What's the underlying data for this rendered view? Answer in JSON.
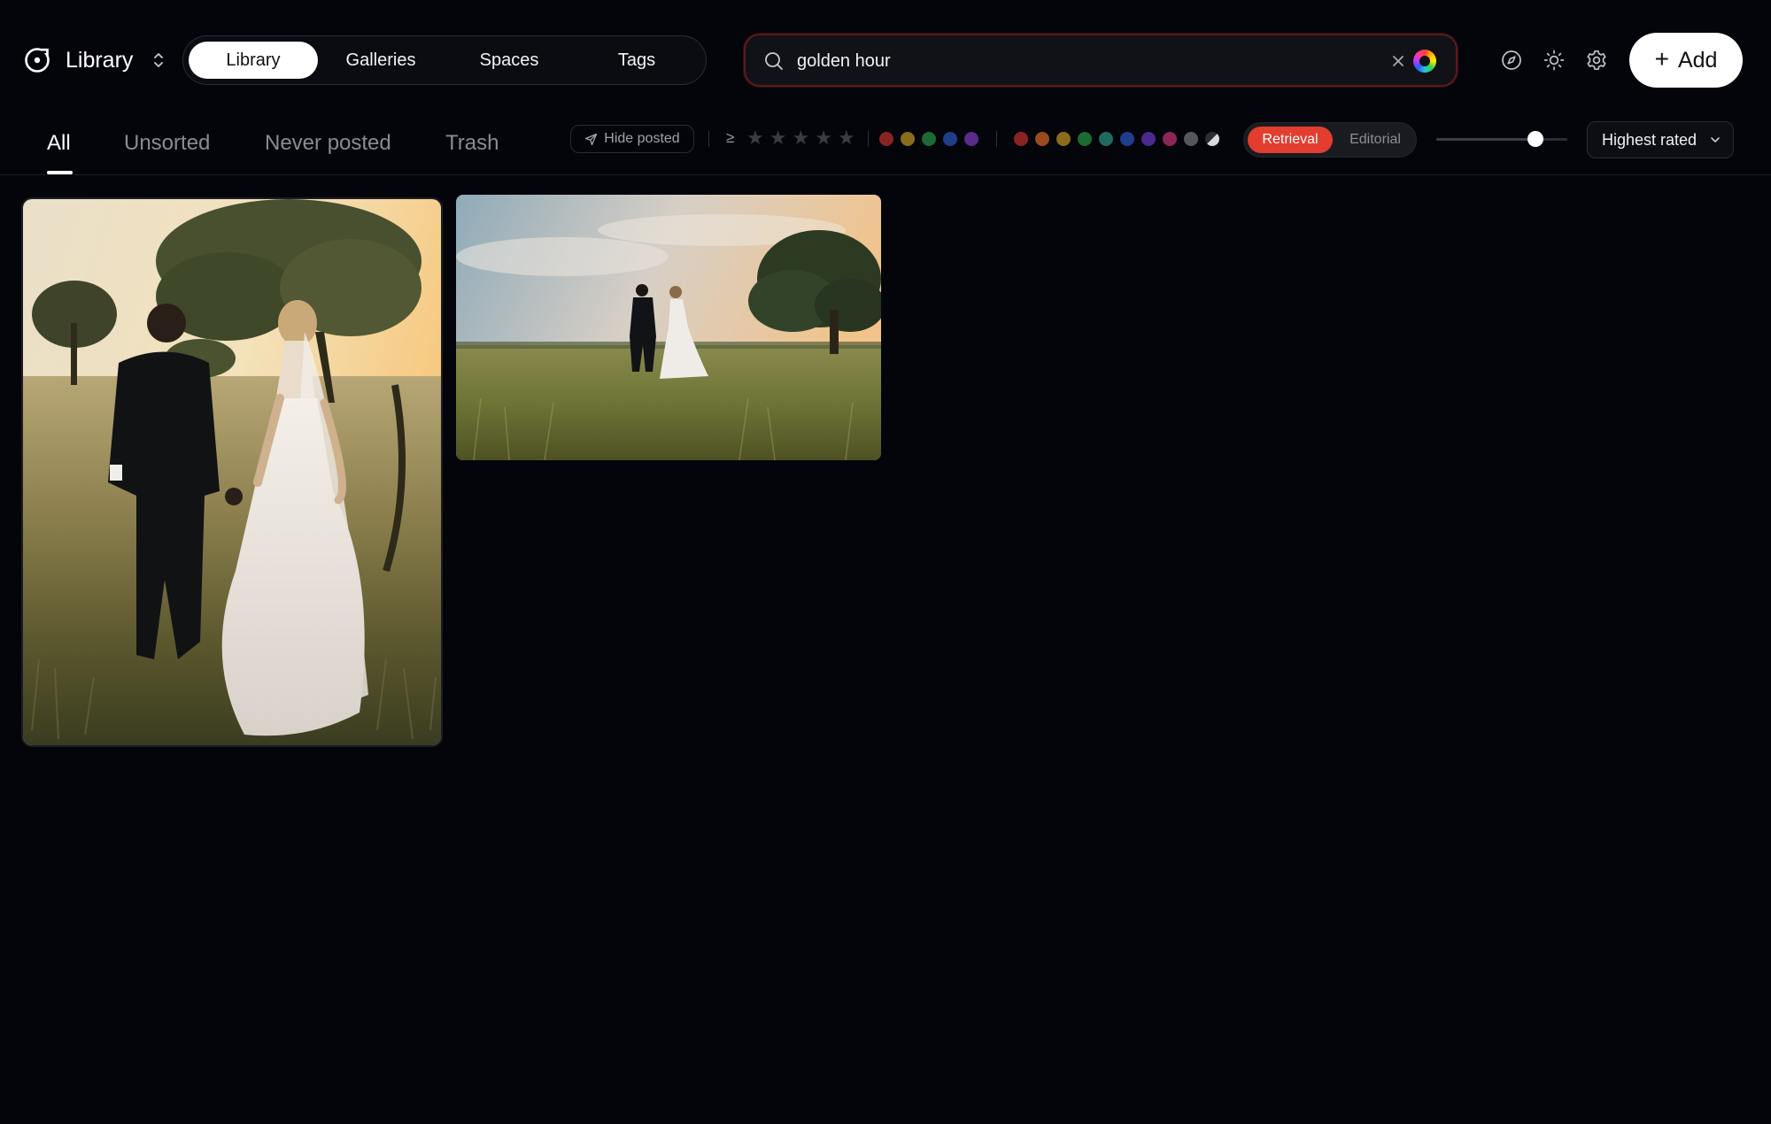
{
  "header": {
    "library_title": "Library",
    "nav_tabs": [
      {
        "label": "Library",
        "active": true
      },
      {
        "label": "Galleries",
        "active": false
      },
      {
        "label": "Spaces",
        "active": false
      },
      {
        "label": "Tags",
        "active": false
      }
    ],
    "search": {
      "value": "golden hour",
      "icon": "search-icon",
      "clear_icon": "close-icon",
      "color_filter_icon": "color-wheel-icon"
    },
    "icons": [
      "compass-icon",
      "sun-icon",
      "gear-icon"
    ],
    "add_label": "Add"
  },
  "filters": {
    "tabs": [
      {
        "label": "All",
        "active": true
      },
      {
        "label": "Unsorted",
        "active": false
      },
      {
        "label": "Never posted",
        "active": false
      },
      {
        "label": "Trash",
        "active": false
      }
    ],
    "hide_posted_label": "Hide posted",
    "rating_prefix": "≥",
    "rating_min": 0,
    "rating_max": 5,
    "label_colors": [
      "#8c2323",
      "#8a6c1c",
      "#1c6a34",
      "#1e3e8c",
      "#5a2a8c"
    ],
    "palette_colors": [
      "#8c2323",
      "#9a4a1c",
      "#8a6c1c",
      "#1c6a34",
      "#1f6a5e",
      "#1e3e8c",
      "#4a2a8c",
      "#8c2656",
      "#55575d"
    ],
    "mode": {
      "options": [
        "Retrieval",
        "Editorial"
      ],
      "selected": "Retrieval"
    },
    "size_slider_level": 0.76,
    "sort": {
      "selected": "Highest rated"
    }
  },
  "photos": [
    {
      "subject": "couple-walking-field-portrait"
    },
    {
      "subject": "couple-walking-field-landscape"
    }
  ]
}
